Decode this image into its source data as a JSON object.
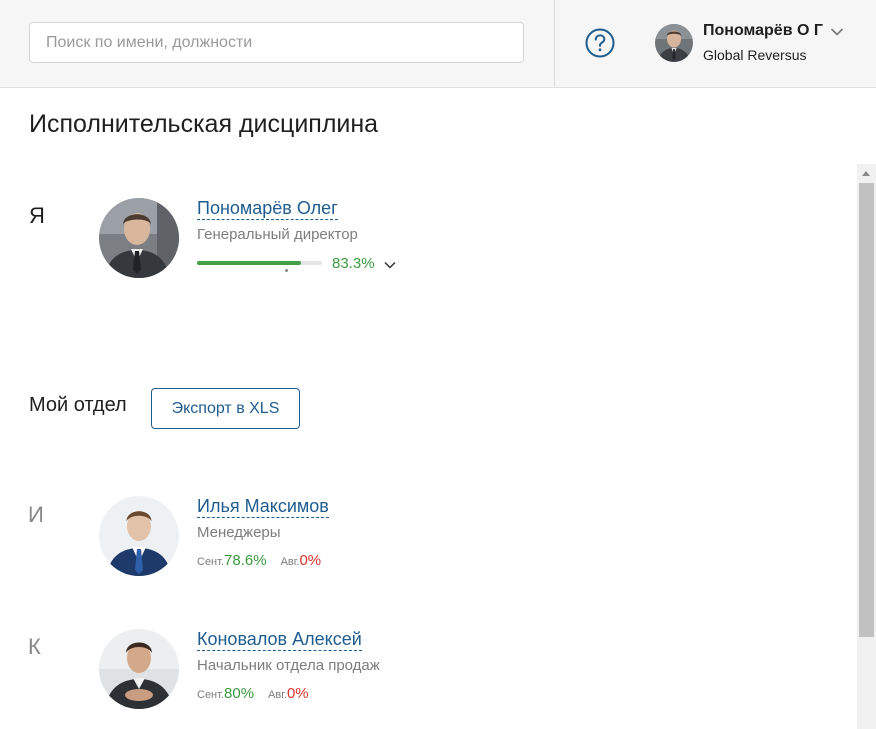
{
  "header": {
    "search_placeholder": "Поиск по имени, должности",
    "help_icon": "question-circle-icon",
    "user": {
      "name": "Пономарёв О Г",
      "company": "Global Reversus"
    }
  },
  "page": {
    "title": "Исполнительская дисциплина"
  },
  "me": {
    "letter": "Я",
    "name": "Пономарёв Олег",
    "position": "Генеральный директор",
    "percent": "83.3%",
    "progress_fraction": 0.833
  },
  "department": {
    "title": "Мой отдел",
    "export_label": "Экспорт в XLS",
    "people": [
      {
        "letter": "И",
        "name": "Илья Максимов",
        "position": "Менеджеры",
        "stat1_label": "Сент.",
        "stat1_value": "78.6%",
        "stat2_label": "Авг.",
        "stat2_value": "0%"
      },
      {
        "letter": "К",
        "name": "Коновалов Алексей",
        "position": "Начальник отдела продаж",
        "stat1_label": "Сент.",
        "stat1_value": "80%",
        "stat2_label": "Авг.",
        "stat2_value": "0%"
      }
    ]
  },
  "colors": {
    "link": "#1f5c8f",
    "green": "#3a9a3e",
    "red": "#d9342b",
    "progress": "#43a047"
  }
}
